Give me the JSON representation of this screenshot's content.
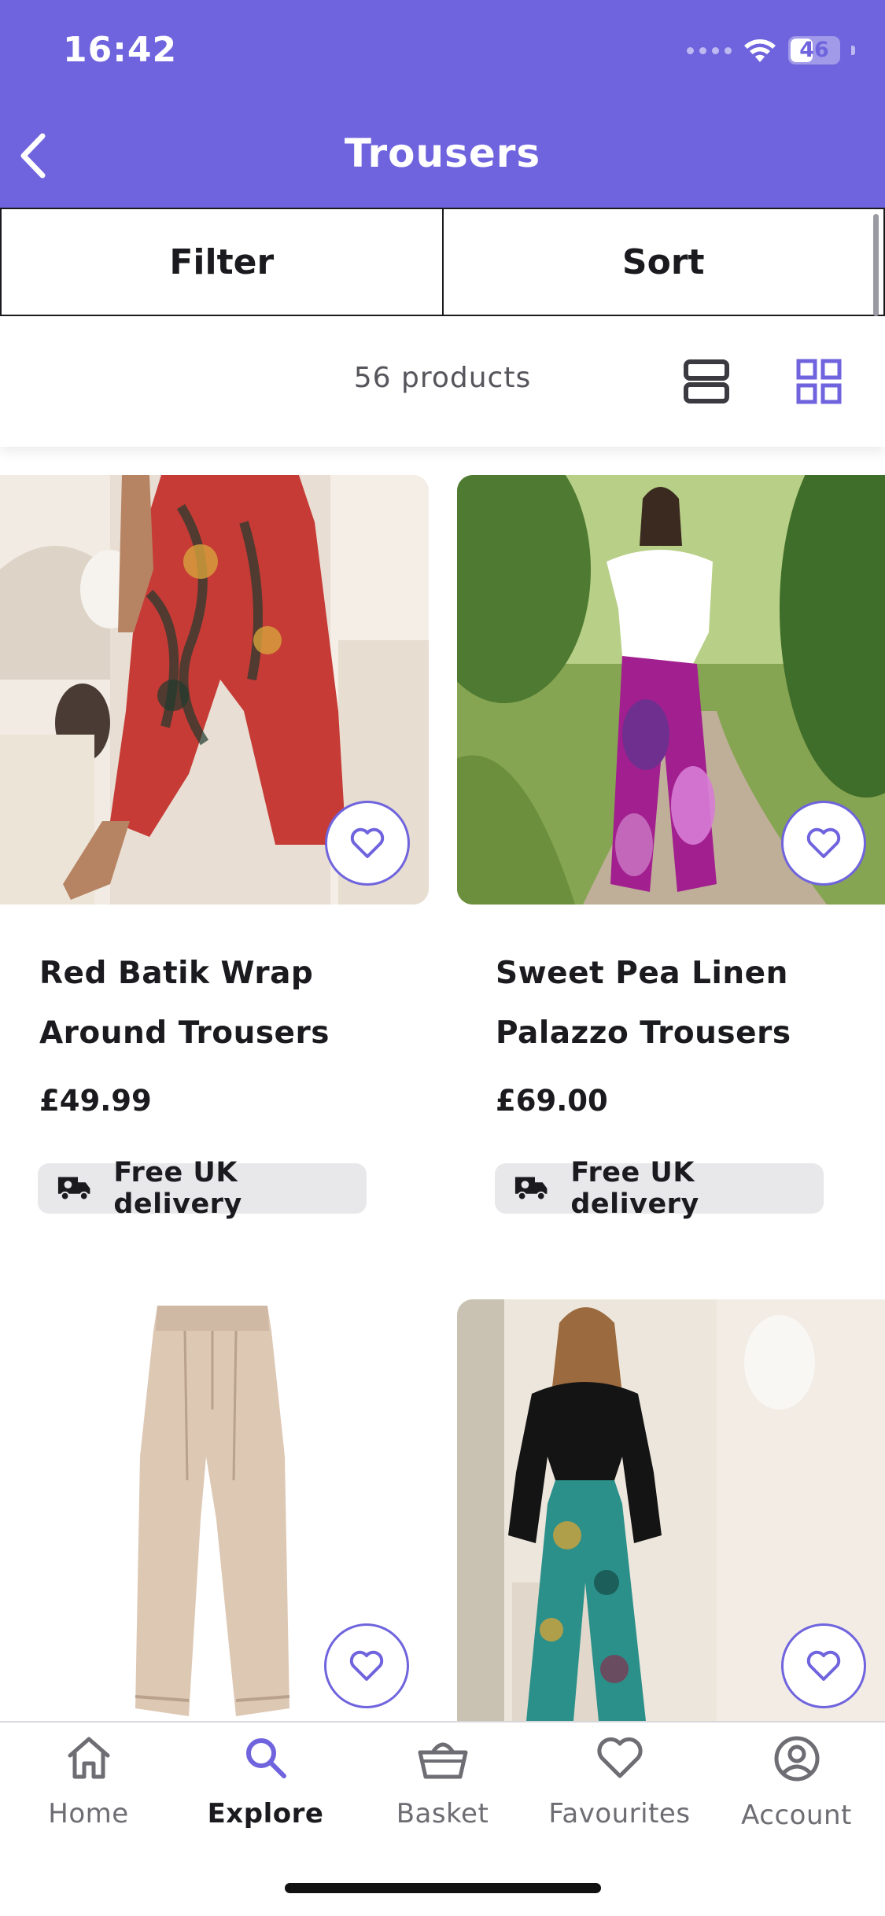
{
  "status_bar": {
    "time": "16:42",
    "battery": "46",
    "battery_level": 0.46
  },
  "header": {
    "title": "Trousers",
    "back_icon": "chevron-left-icon"
  },
  "toolbar": {
    "filter_label": "Filter",
    "sort_label": "Sort"
  },
  "results": {
    "count_text": "56 products",
    "active_view": "grid"
  },
  "products": [
    {
      "name_line1": "Red Batik Wrap",
      "name_line2": "Around Trousers",
      "price": "£49.99",
      "delivery": "Free UK delivery"
    },
    {
      "name_line1": "Sweet Pea Linen",
      "name_line2": "Palazzo Trousers",
      "price": "£69.00",
      "delivery": "Free UK delivery"
    },
    {
      "name_line1": "",
      "name_line2": "",
      "price": "",
      "delivery": ""
    },
    {
      "name_line1": "",
      "name_line2": "",
      "price": "",
      "delivery": ""
    }
  ],
  "nav": {
    "items": [
      {
        "label": "Home",
        "icon": "home-icon"
      },
      {
        "label": "Explore",
        "icon": "search-icon",
        "active": true
      },
      {
        "label": "Basket",
        "icon": "basket-icon"
      },
      {
        "label": "Favourites",
        "icon": "heart-icon"
      },
      {
        "label": "Account",
        "icon": "account-icon"
      }
    ]
  },
  "colors": {
    "brand": "#6f64dd",
    "text": "#1b1b1f",
    "badge_bg": "#e8e8ea"
  }
}
